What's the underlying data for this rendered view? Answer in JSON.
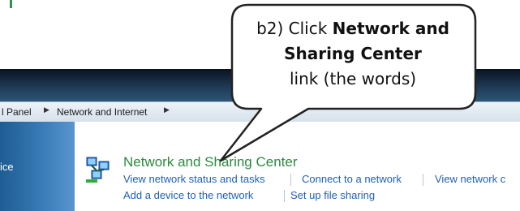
{
  "callout": {
    "prefix": "b2) Click ",
    "bold": "Network and Sharing Center",
    "suffix": "link (the words)"
  },
  "address_bar": {
    "crumbs": [
      "l Panel",
      "Network and Internet"
    ],
    "separator_icon": "right-arrow-icon"
  },
  "left_pane": {
    "text": "ice"
  },
  "category": {
    "icon": "network-icon",
    "title": "Network and Sharing Center",
    "links_row1": [
      "View network status and tasks",
      "Connect to a network",
      "View network c"
    ],
    "links_row2": [
      "Add a device to the network",
      "Set up file sharing"
    ]
  },
  "colors": {
    "category_title": "#2b8a3e",
    "link": "#1f5fb6",
    "titlebar": "#1f3a55",
    "left_pane": "#3b7dba"
  }
}
